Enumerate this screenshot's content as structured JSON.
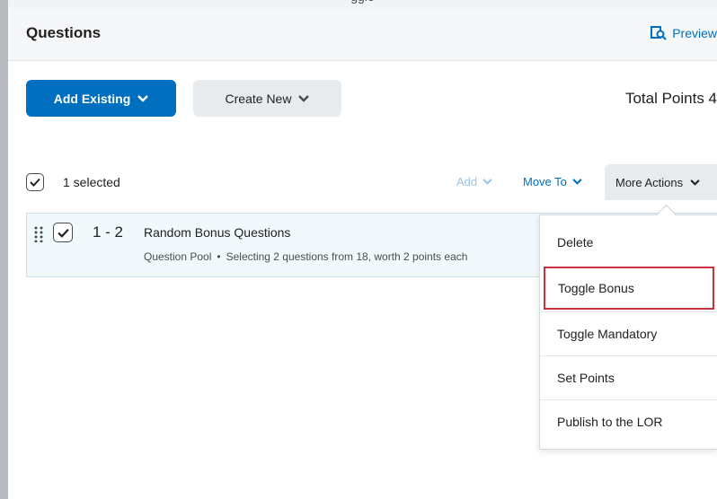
{
  "top_partial_text": "ggle",
  "header": {
    "title": "Questions",
    "preview_label": "Preview"
  },
  "actions": {
    "add_existing_label": "Add Existing",
    "create_new_label": "Create New",
    "total_points_label": "Total Points 4"
  },
  "toolbar": {
    "selected_label": "1 selected",
    "add_label": "Add",
    "move_to_label": "Move To",
    "more_actions_label": "More Actions"
  },
  "question_row": {
    "range": "1 - 2",
    "title": "Random Bonus Questions",
    "type": "Question Pool",
    "bullet": "•",
    "description": "Selecting 2 questions from 18, worth 2 points each"
  },
  "menu": {
    "items": [
      {
        "label": "Delete"
      },
      {
        "label": "Toggle Bonus"
      },
      {
        "label": "Toggle Mandatory"
      },
      {
        "label": "Set Points"
      },
      {
        "label": "Publish to the LOR"
      }
    ],
    "highlighted_index": 1
  },
  "colors": {
    "accent": "#006fbf",
    "highlight_border": "#c7323b",
    "row_background": "#f2f9fd"
  }
}
